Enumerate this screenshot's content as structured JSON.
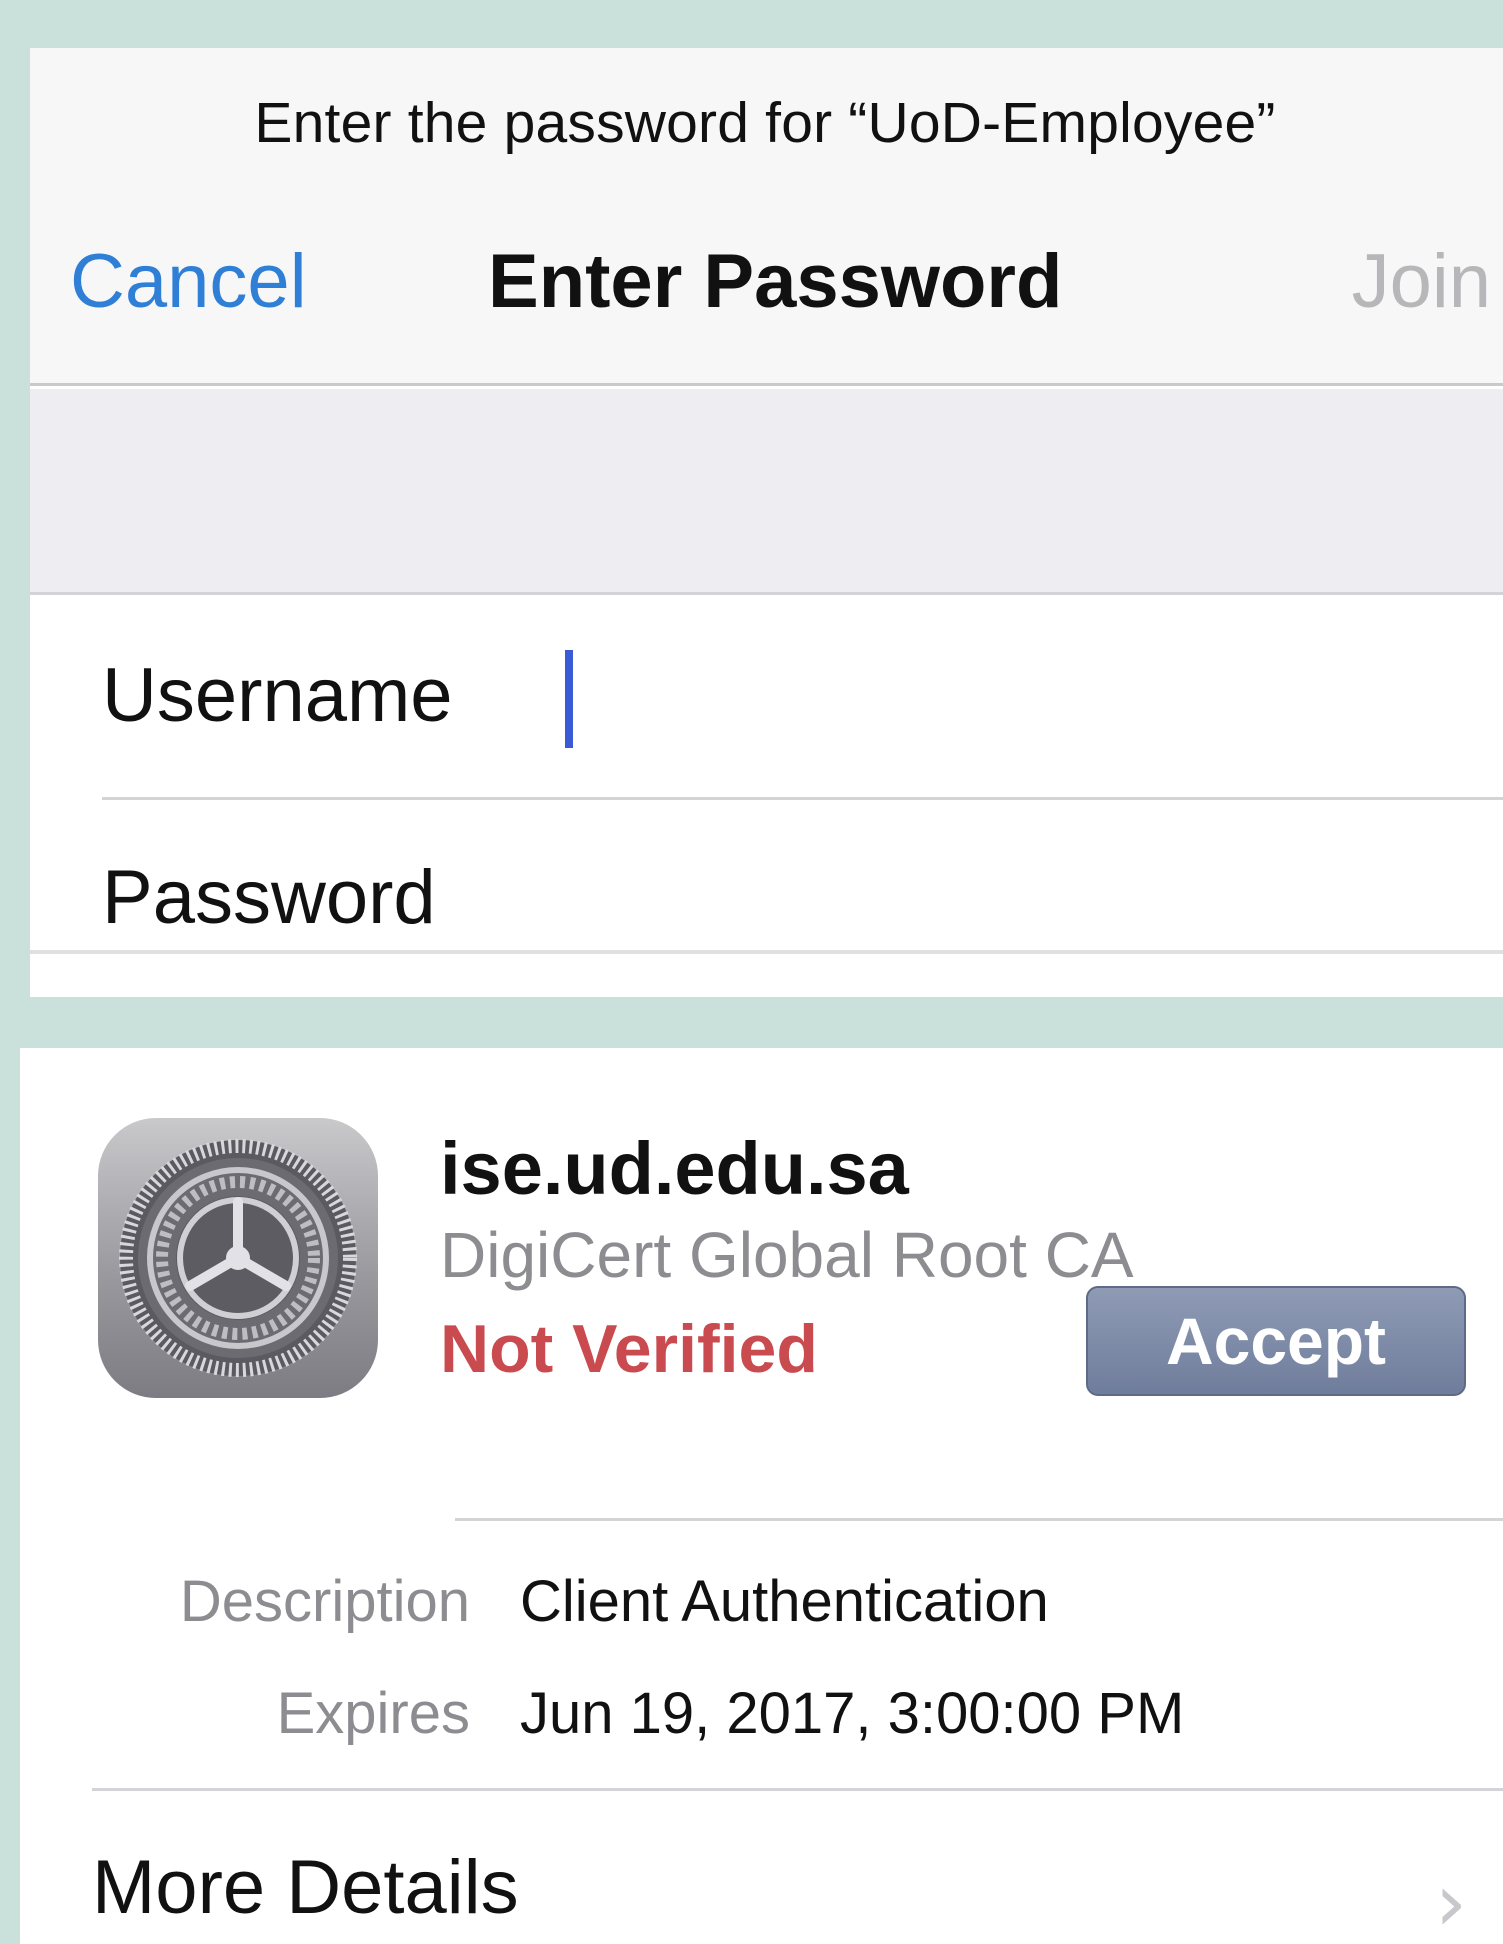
{
  "dialog": {
    "prompt": "Enter the password for “UoD-Employee”",
    "nav": {
      "cancel_label": "Cancel",
      "title": "Enter Password",
      "join_label": "Join"
    },
    "fields": {
      "username_label": "Username",
      "username_value": "",
      "password_label": "Password",
      "password_value": ""
    }
  },
  "certificate": {
    "icon": "settings-gear-icon",
    "name": "ise.ud.edu.sa",
    "issuer": "DigiCert Global Root CA",
    "status": "Not Verified",
    "accept_label": "Accept",
    "details": [
      {
        "label": "Description",
        "value": "Client Authentication"
      },
      {
        "label": "Expires",
        "value": "Jun 19, 2017, 3:00:00 PM"
      }
    ],
    "more_details_label": "More Details",
    "chevron": "›"
  },
  "colors": {
    "background": "#c9e0db",
    "link_blue": "#2f7fd6",
    "disabled_gray": "#b7b7b9",
    "warning_red": "#c94a4f",
    "accept_button": "#7886a5",
    "caret": "#3b5bd6"
  }
}
